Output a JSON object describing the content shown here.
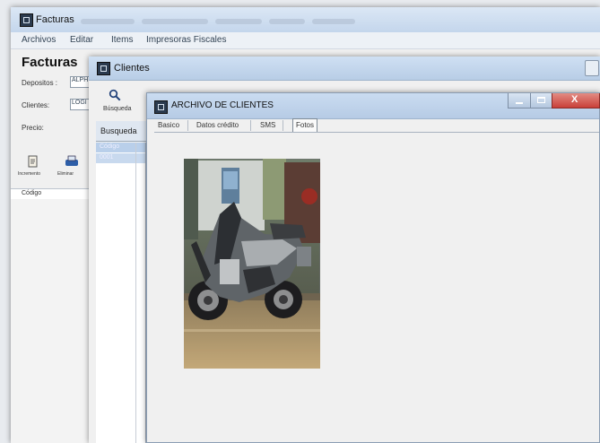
{
  "facturas_window": {
    "title": "Facturas",
    "menu": [
      "Archivos",
      "Editar",
      "Items",
      "Impresoras Fiscales"
    ],
    "heading": "Facturas",
    "fields": [
      {
        "label": "Depositos :",
        "value": "ALPH"
      },
      {
        "label": "Clientes:",
        "value": "LOGI"
      },
      {
        "label": "Precio:",
        "value": ""
      }
    ],
    "toolbar": [
      "Incremento",
      "Eliminar"
    ],
    "list_header": "Código"
  },
  "clientes_window": {
    "title": "Clientes",
    "search_button": "Búsqueda",
    "search_tab": "Busqueda",
    "list_rows": [
      "Código",
      "0001"
    ]
  },
  "archivo_window": {
    "title": "ARCHIVO DE CLIENTES",
    "tabs": [
      "Basico",
      "Datos crédito",
      "SMS",
      "Fotos"
    ],
    "active_tab": "Fotos",
    "close_label": "X"
  },
  "colors": {
    "titlebar": "#c6d8ee",
    "window_bg": "#f0f0f0",
    "selection": "#b9cfea",
    "close_button": "#c9403a"
  },
  "icons": [
    "app-icon",
    "search-icon",
    "print-icon",
    "close-icon",
    "minimize-icon",
    "maximize-icon",
    "photo-motorcycle"
  ]
}
